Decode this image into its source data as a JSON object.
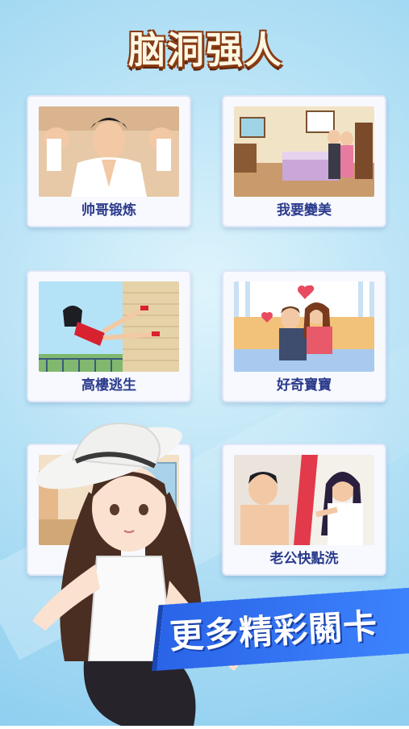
{
  "logo": {
    "text": "脑洞强人"
  },
  "levels": [
    {
      "label": "帅哥锻炼",
      "icon": "muscle-man-image"
    },
    {
      "label": "我要變美",
      "icon": "bedroom-couple-image"
    },
    {
      "label": "高樓逃生",
      "icon": "falling-girl-image"
    },
    {
      "label": "好奇寶寶",
      "icon": "hugging-couple-image"
    },
    {
      "label": "",
      "icon": "hidden-level-image"
    },
    {
      "label": "老公快點洗",
      "icon": "bath-couple-image"
    }
  ],
  "banner": {
    "text": "更多精彩關卡"
  },
  "colors": {
    "banner": "#2f6ff0",
    "label": "#2b3b8c",
    "logo_outline": "#8a3a12"
  }
}
